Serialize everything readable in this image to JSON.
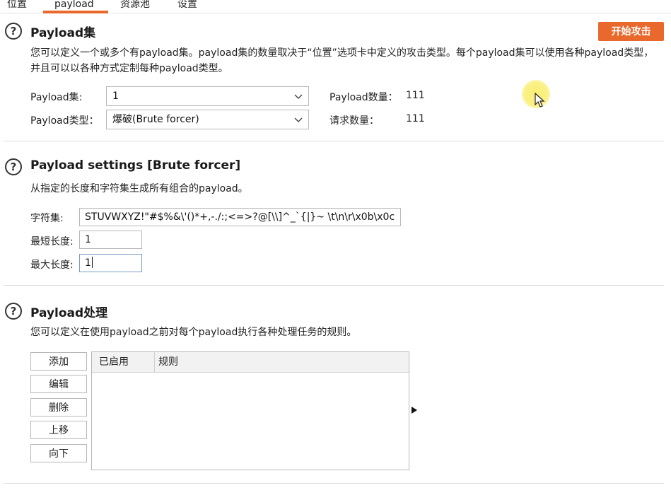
{
  "tabs": [
    {
      "label": "位置",
      "active": false
    },
    {
      "label": "payload",
      "active": true
    },
    {
      "label": "资源池",
      "active": false
    },
    {
      "label": "设置",
      "active": false
    }
  ],
  "accent_color": "#e8692b",
  "payload_sets": {
    "title": "Payload集",
    "description": "您可以定义一个或多个有payload集。payload集的数量取决于“位置”选项卡中定义的攻击类型。每个payload集可以使用各种payload类型，并且可以以各种方式定制每种payload类型。",
    "start_attack_label": "开始攻击",
    "set_label": "Payload集:",
    "set_value": "1",
    "type_label": "Payload类型：",
    "type_value": "爆破(Brute forcer)",
    "count_label": "Payload数量：",
    "count_value": "111",
    "request_label": "请求数量：",
    "request_value": "111"
  },
  "payload_settings": {
    "title": "Payload settings [Brute forcer]",
    "description": "从指定的长度和字符集生成所有组合的payload。",
    "charset_label": "字符集:",
    "charset_value": "STUVWXYZ!\"#$%&\\'()*+,-./:;<=>?@[\\\\]^_`{|}~ \\t\\n\\r\\x0b\\x0c",
    "min_label": "最短长度:",
    "min_value": "1",
    "max_label": "最大长度:",
    "max_value": "1"
  },
  "payload_processing": {
    "title": "Payload处理",
    "description": "您可以定义在使用payload之前对每个payload执行各种处理任务的规则。",
    "buttons": {
      "add": "添加",
      "edit": "编辑",
      "remove": "删除",
      "up": "上移",
      "down": "向下"
    },
    "columns": [
      "已启用",
      "规则"
    ]
  }
}
